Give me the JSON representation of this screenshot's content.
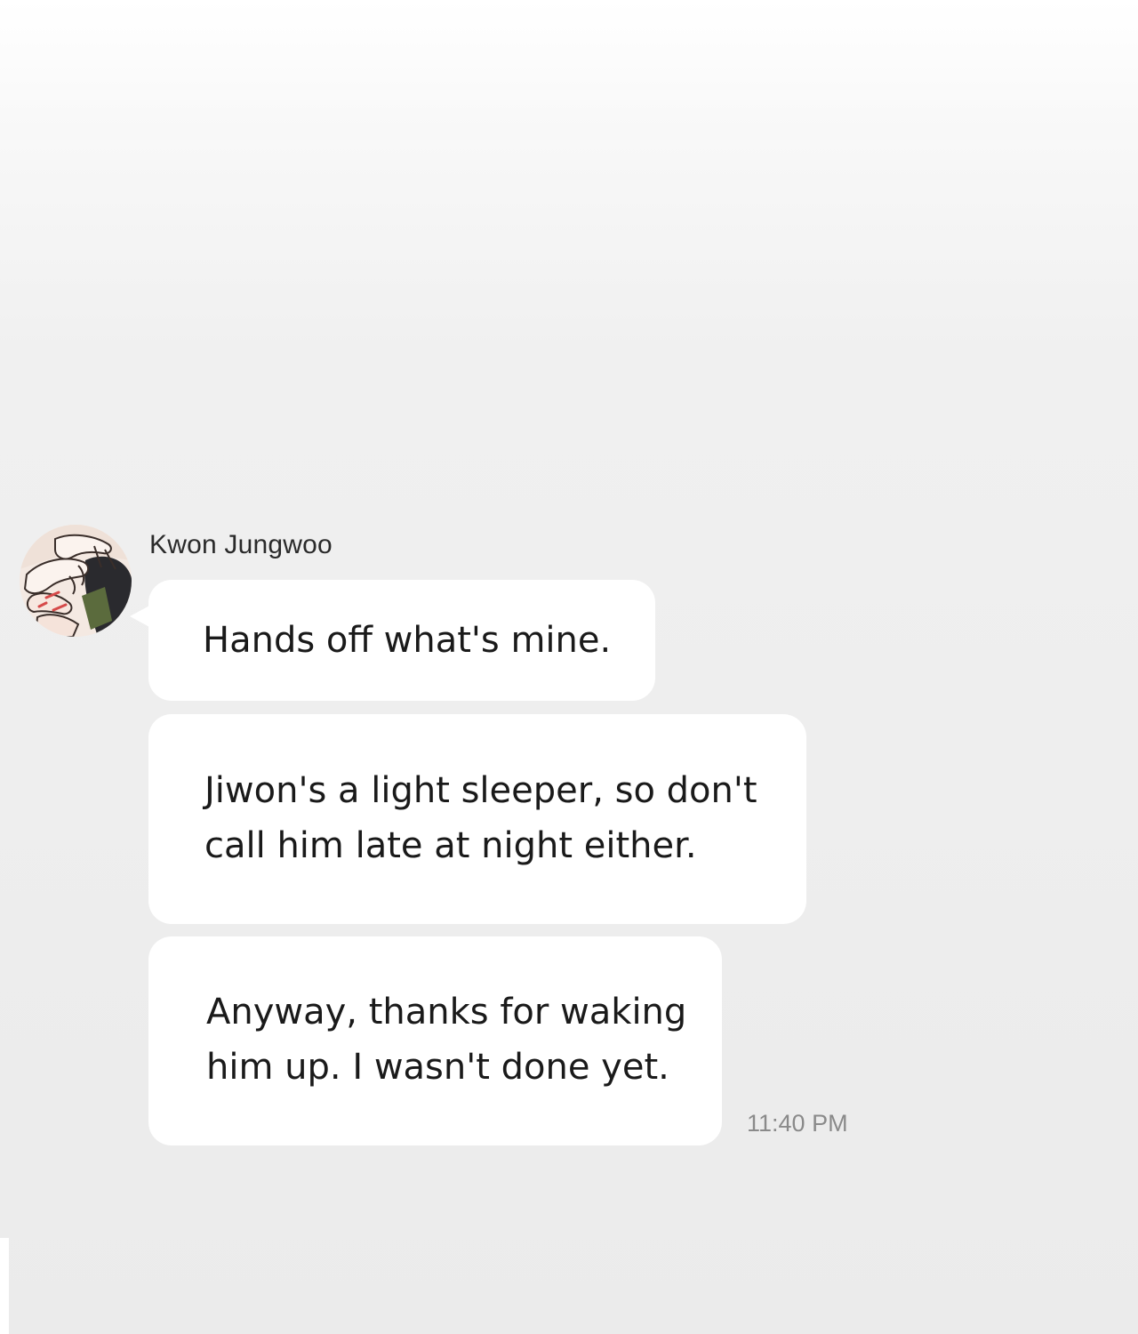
{
  "conversation": {
    "sender": {
      "name": "Kwon Jungwoo",
      "avatar_icon": "profile-avatar-image"
    },
    "messages": [
      {
        "lines": [
          "Hands off what's mine."
        ]
      },
      {
        "lines": [
          "Jiwon's a light sleeper, so don't",
          "call him late at night either."
        ]
      },
      {
        "lines": [
          "Anyway, thanks for waking",
          "him up. I wasn't done yet."
        ]
      }
    ],
    "timestamp": "11:40 PM"
  },
  "colors": {
    "bubble": "#ffffff",
    "background": "#ebebeb",
    "timestamp": "#8a8a8a"
  }
}
